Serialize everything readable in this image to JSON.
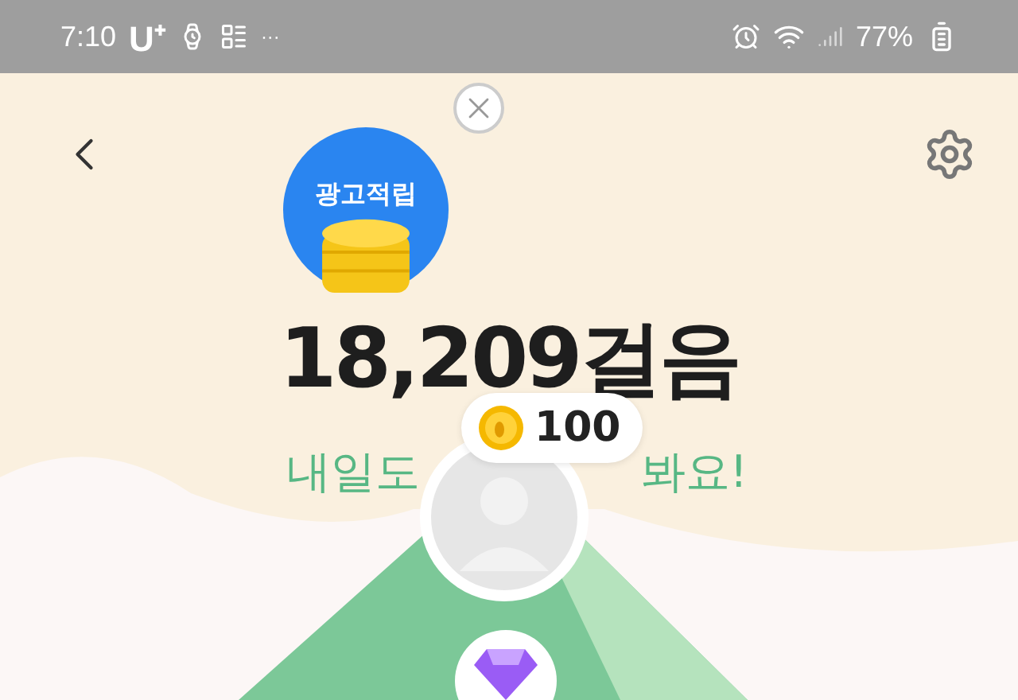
{
  "status_bar": {
    "time": "7:10",
    "carrier": "U⁺",
    "battery": "77%",
    "more": "···"
  },
  "badge": {
    "label": "광고적립"
  },
  "steps": {
    "count": "18,209걸음"
  },
  "subtitle": {
    "left": "내일도",
    "right": "봐요!"
  },
  "reward_bubble": {
    "amount": "100"
  }
}
